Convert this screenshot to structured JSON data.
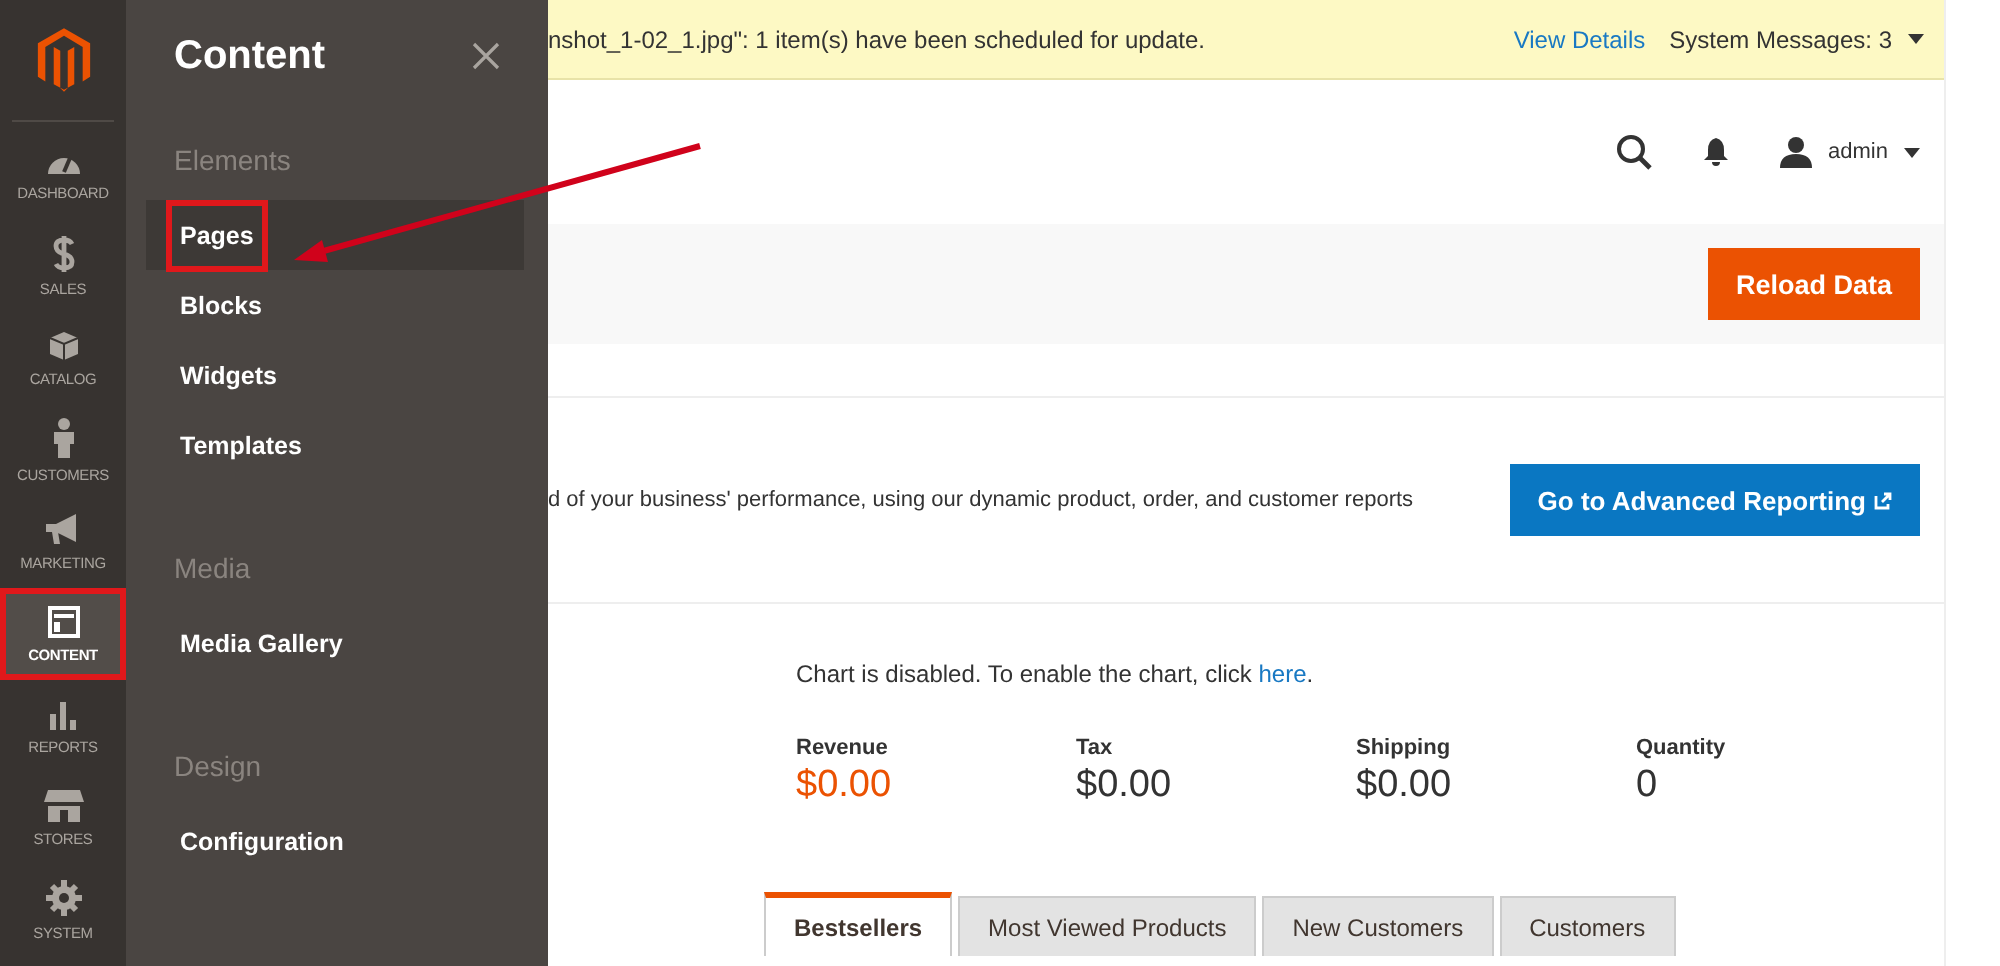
{
  "nav": {
    "items": [
      {
        "kind": "dashboard",
        "label": "DASHBOARD",
        "selected": false,
        "highlighted": false
      },
      {
        "kind": "sales",
        "label": "SALES",
        "selected": false,
        "highlighted": false
      },
      {
        "kind": "catalog",
        "label": "CATALOG",
        "selected": false,
        "highlighted": false
      },
      {
        "kind": "customers",
        "label": "CUSTOMERS",
        "selected": false,
        "highlighted": false
      },
      {
        "kind": "marketing",
        "label": "MARKETING",
        "selected": false,
        "highlighted": false
      },
      {
        "kind": "content",
        "label": "CONTENT",
        "selected": true,
        "highlighted": true
      },
      {
        "kind": "reports",
        "label": "REPORTS",
        "selected": false,
        "highlighted": false
      },
      {
        "kind": "stores",
        "label": "STORES",
        "selected": false,
        "highlighted": false
      },
      {
        "kind": "system",
        "label": "SYSTEM",
        "selected": false,
        "highlighted": false
      }
    ]
  },
  "flyout": {
    "title": "Content",
    "sections": [
      {
        "title": "Elements",
        "items": [
          {
            "label": "Pages",
            "selected": true,
            "highlighted": true
          },
          {
            "label": "Blocks",
            "selected": false,
            "highlighted": false
          },
          {
            "label": "Widgets",
            "selected": false,
            "highlighted": false
          },
          {
            "label": "Templates",
            "selected": false,
            "highlighted": false
          }
        ]
      },
      {
        "title": "Media",
        "items": [
          {
            "label": "Media Gallery",
            "selected": false,
            "highlighted": false
          }
        ]
      },
      {
        "title": "Design",
        "items": [
          {
            "label": "Configuration",
            "selected": false,
            "highlighted": false
          }
        ]
      }
    ]
  },
  "message_bar": {
    "text": "nshot_1-02_1.jpg\": 1 item(s) have been scheduled for update.",
    "link": "View Details",
    "system_messages": "System Messages: 3"
  },
  "header": {
    "user": "admin"
  },
  "reload_button": "Reload Data",
  "reporting": {
    "text": "d of your business' performance, using our dynamic product, order, and customer reports",
    "button": "Go to Advanced Reporting"
  },
  "chart_notice": {
    "text": "Chart is disabled. To enable the chart, click",
    "link": "here",
    "after": "."
  },
  "stats": [
    {
      "label": "Revenue",
      "value": "$0.00",
      "accent": true
    },
    {
      "label": "Tax",
      "value": "$0.00",
      "accent": false
    },
    {
      "label": "Shipping",
      "value": "$0.00",
      "accent": false
    },
    {
      "label": "Quantity",
      "value": "0",
      "accent": false
    }
  ],
  "tabs": [
    {
      "label": "Bestsellers",
      "selected": true
    },
    {
      "label": "Most Viewed Products",
      "selected": false
    },
    {
      "label": "New Customers",
      "selected": false
    },
    {
      "label": "Customers",
      "selected": false
    }
  ]
}
